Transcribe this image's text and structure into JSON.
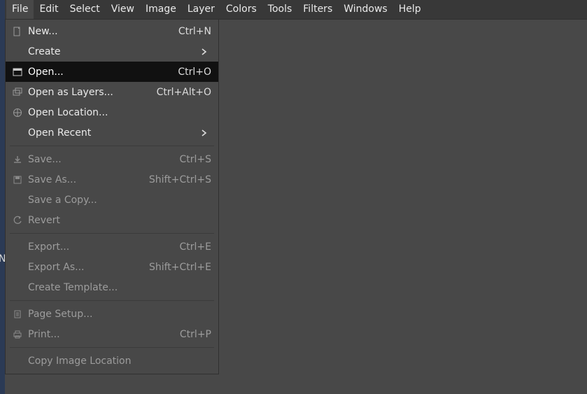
{
  "left_strip_hint": "N",
  "menubar": {
    "items": [
      {
        "label": "File",
        "active": true
      },
      {
        "label": "Edit",
        "active": false
      },
      {
        "label": "Select",
        "active": false
      },
      {
        "label": "View",
        "active": false
      },
      {
        "label": "Image",
        "active": false
      },
      {
        "label": "Layer",
        "active": false
      },
      {
        "label": "Colors",
        "active": false
      },
      {
        "label": "Tools",
        "active": false
      },
      {
        "label": "Filters",
        "active": false
      },
      {
        "label": "Windows",
        "active": false
      },
      {
        "label": "Help",
        "active": false
      }
    ]
  },
  "file_menu": {
    "groups": [
      [
        {
          "icon": "document-new",
          "label": "New...",
          "accel": "Ctrl+N",
          "sub": false,
          "disabled": false,
          "highlight": false
        },
        {
          "icon": "",
          "label": "Create",
          "accel": "",
          "sub": true,
          "disabled": false,
          "highlight": false
        },
        {
          "icon": "document-open",
          "label": "Open...",
          "accel": "Ctrl+O",
          "sub": false,
          "disabled": false,
          "highlight": true
        },
        {
          "icon": "layers",
          "label": "Open as Layers...",
          "accel": "Ctrl+Alt+O",
          "sub": false,
          "disabled": false,
          "highlight": false
        },
        {
          "icon": "globe",
          "label": "Open Location...",
          "accel": "",
          "sub": false,
          "disabled": false,
          "highlight": false
        },
        {
          "icon": "",
          "label": "Open Recent",
          "accel": "",
          "sub": true,
          "disabled": false,
          "highlight": false
        }
      ],
      [
        {
          "icon": "save",
          "label": "Save...",
          "accel": "Ctrl+S",
          "sub": false,
          "disabled": true,
          "highlight": false
        },
        {
          "icon": "save-as",
          "label": "Save As...",
          "accel": "Shift+Ctrl+S",
          "sub": false,
          "disabled": true,
          "highlight": false
        },
        {
          "icon": "",
          "label": "Save a Copy...",
          "accel": "",
          "sub": false,
          "disabled": true,
          "highlight": false
        },
        {
          "icon": "revert",
          "label": "Revert",
          "accel": "",
          "sub": false,
          "disabled": true,
          "highlight": false
        }
      ],
      [
        {
          "icon": "",
          "label": "Export...",
          "accel": "Ctrl+E",
          "sub": false,
          "disabled": true,
          "highlight": false
        },
        {
          "icon": "",
          "label": "Export As...",
          "accel": "Shift+Ctrl+E",
          "sub": false,
          "disabled": true,
          "highlight": false
        },
        {
          "icon": "",
          "label": "Create Template...",
          "accel": "",
          "sub": false,
          "disabled": true,
          "highlight": false
        }
      ],
      [
        {
          "icon": "page-setup",
          "label": "Page Setup...",
          "accel": "",
          "sub": false,
          "disabled": true,
          "highlight": false
        },
        {
          "icon": "print",
          "label": "Print...",
          "accel": "Ctrl+P",
          "sub": false,
          "disabled": true,
          "highlight": false
        }
      ],
      [
        {
          "icon": "",
          "label": "Copy Image Location",
          "accel": "",
          "sub": false,
          "disabled": true,
          "highlight": false
        }
      ]
    ]
  }
}
